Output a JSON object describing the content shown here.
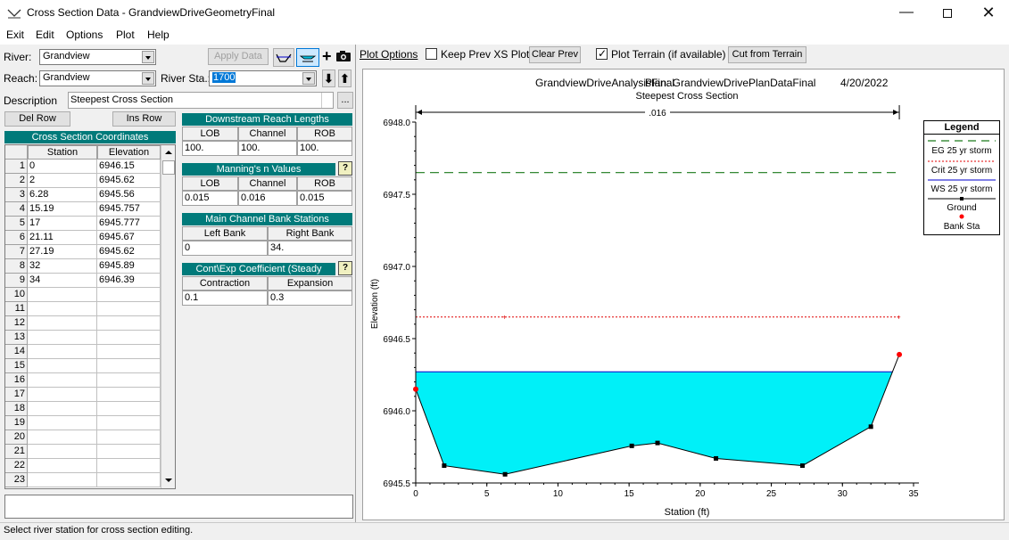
{
  "window": {
    "title": "Cross Section Data - GrandviewDriveGeometryFinal"
  },
  "menu": [
    "Exit",
    "Edit",
    "Options",
    "Plot",
    "Help"
  ],
  "form": {
    "river_label": "River:",
    "river_value": "Grandview",
    "reach_label": "Reach:",
    "reach_value": "Grandview",
    "river_sta_label": "River Sta.:",
    "river_sta_value": "1700",
    "description_label": "Description",
    "description_value": "Steepest Cross Section",
    "apply_data": "Apply Data",
    "del_row": "Del Row",
    "ins_row": "Ins Row",
    "ellipsis": "..."
  },
  "coords": {
    "title": "Cross Section Coordinates",
    "col_station": "Station",
    "col_elevation": "Elevation",
    "rows": [
      {
        "n": "1",
        "station": "0",
        "elevation": "6946.15"
      },
      {
        "n": "2",
        "station": "2",
        "elevation": "6945.62"
      },
      {
        "n": "3",
        "station": "6.28",
        "elevation": "6945.56"
      },
      {
        "n": "4",
        "station": "15.19",
        "elevation": "6945.757"
      },
      {
        "n": "5",
        "station": "17",
        "elevation": "6945.777"
      },
      {
        "n": "6",
        "station": "21.11",
        "elevation": "6945.67"
      },
      {
        "n": "7",
        "station": "27.19",
        "elevation": "6945.62"
      },
      {
        "n": "8",
        "station": "32",
        "elevation": "6945.89"
      },
      {
        "n": "9",
        "station": "34",
        "elevation": "6946.39"
      },
      {
        "n": "10",
        "station": "",
        "elevation": ""
      },
      {
        "n": "11",
        "station": "",
        "elevation": ""
      },
      {
        "n": "12",
        "station": "",
        "elevation": ""
      },
      {
        "n": "13",
        "station": "",
        "elevation": ""
      },
      {
        "n": "14",
        "station": "",
        "elevation": ""
      },
      {
        "n": "15",
        "station": "",
        "elevation": ""
      },
      {
        "n": "16",
        "station": "",
        "elevation": ""
      },
      {
        "n": "17",
        "station": "",
        "elevation": ""
      },
      {
        "n": "18",
        "station": "",
        "elevation": ""
      },
      {
        "n": "19",
        "station": "",
        "elevation": ""
      },
      {
        "n": "20",
        "station": "",
        "elevation": ""
      },
      {
        "n": "21",
        "station": "",
        "elevation": ""
      },
      {
        "n": "22",
        "station": "",
        "elevation": ""
      },
      {
        "n": "23",
        "station": "",
        "elevation": ""
      }
    ]
  },
  "reach_lengths": {
    "title": "Downstream Reach Lengths",
    "lob_h": "LOB",
    "channel_h": "Channel",
    "rob_h": "ROB",
    "lob": "100.",
    "channel": "100.",
    "rob": "100."
  },
  "mannings": {
    "title": "Manning's n Values",
    "help": "?",
    "lob_h": "LOB",
    "channel_h": "Channel",
    "rob_h": "ROB",
    "lob": "0.015",
    "channel": "0.016",
    "rob": "0.015"
  },
  "bank_stations": {
    "title": "Main Channel Bank Stations",
    "left_h": "Left Bank",
    "right_h": "Right Bank",
    "left": "0",
    "right": "34."
  },
  "coefficients": {
    "title": "Cont\\Exp Coefficient (Steady",
    "help": "?",
    "contraction_h": "Contraction",
    "expansion_h": "Expansion",
    "contraction": "0.1",
    "expansion": "0.3"
  },
  "plot_toolbar": {
    "plot_options": "Plot Options",
    "keep_prev": "Keep Prev XS Plots",
    "keep_prev_checked": false,
    "clear_prev": "Clear Prev",
    "plot_terrain": "Plot Terrain (if available)",
    "plot_terrain_checked": true,
    "cut_from_terrain": "Cut from Terrain"
  },
  "status_text": "Select river station for cross section editing.",
  "chart_data": {
    "type": "line",
    "title_left": "GrandviewDriveAnalysisFinal",
    "title_plan": "Plan: GrandviewDrivePlanDataFinal",
    "title_date": "4/20/2022",
    "subtitle": "Steepest Cross Section",
    "xlabel": "Station (ft)",
    "ylabel": "Elevation (ft)",
    "xlim": [
      0,
      35
    ],
    "ylim": [
      6945.5,
      6948.0
    ],
    "x_ticks": [
      "0",
      "5",
      "10",
      "15",
      "20",
      "25",
      "30",
      "35"
    ],
    "y_ticks": [
      "6945.5",
      "6946.0",
      "6946.5",
      "6947.0",
      "6947.5",
      "6948.0"
    ],
    "mannings_label": ".016",
    "ground": {
      "name": "Ground",
      "x": [
        0,
        2,
        6.28,
        15.19,
        17,
        21.11,
        27.19,
        32,
        34
      ],
      "y": [
        6946.15,
        6945.62,
        6945.56,
        6945.757,
        6945.777,
        6945.67,
        6945.62,
        6945.89,
        6946.39
      ]
    },
    "bank_stations": {
      "name": "Bank Sta",
      "x": [
        0,
        34
      ],
      "y": [
        6946.15,
        6946.39
      ]
    },
    "eg": {
      "name": "EG 25 yr storm",
      "y": 6947.65
    },
    "crit": {
      "name": "Crit 25 yr storm",
      "y": 6946.65
    },
    "ws": {
      "name": "WS 25 yr storm",
      "y": 6946.27
    },
    "legend_title": "Legend",
    "legend_placement": "right",
    "colors": {
      "eg": "#1a7a1a",
      "crit": "#e00000",
      "ws": "#0000cc",
      "water": "#00f0f8",
      "bank": "#ff0000"
    }
  }
}
